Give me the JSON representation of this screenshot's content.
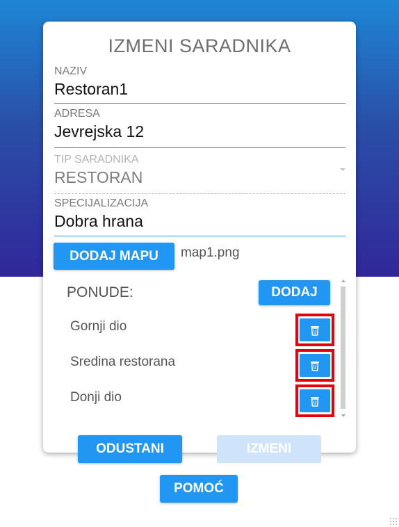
{
  "dialog": {
    "title": "IZMENI SARADNIKA"
  },
  "fields": {
    "naziv": {
      "label": "NAZIV",
      "value": "Restoran1"
    },
    "adresa": {
      "label": "ADRESA",
      "value": "Jevrejska 12"
    },
    "tip": {
      "label": "TIP SARADNIKA",
      "value": "RESTORAN",
      "disabled": true
    },
    "specijalizacija": {
      "label": "SPECIJALIZACIJA",
      "value": "Dobra hrana"
    }
  },
  "map": {
    "button_label": "DODAJ MAPU",
    "file_name": "map1.png"
  },
  "ponude": {
    "title": "PONUDE:",
    "add_label": "DODAJ",
    "items": [
      {
        "label": "Gornji dio",
        "delete_icon": "trash-icon"
      },
      {
        "label": "Sredina restorana",
        "delete_icon": "trash-icon"
      },
      {
        "label": "Donji dio",
        "delete_icon": "trash-icon"
      }
    ]
  },
  "actions": {
    "cancel_label": "ODUSTANI",
    "save_label": "IZMENI",
    "save_disabled": true,
    "help_label": "POMOĆ"
  },
  "colors": {
    "primary": "#2196f3",
    "highlight": "#e5000c",
    "gradient_top": "#1e86d6",
    "gradient_bottom": "#31279a"
  }
}
